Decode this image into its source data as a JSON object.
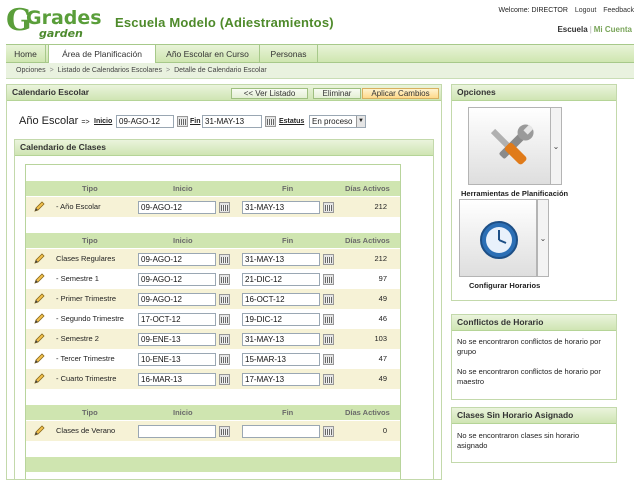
{
  "header": {
    "logo_top": "Grades",
    "logo_bottom": "garden",
    "school_title": "Escuela Modelo (Adiestramientos)",
    "welcome": "Welcome: DIRECTOR",
    "logout": "Logout",
    "feedback": "Feedback",
    "account_active": "Escuela",
    "account_inactive": "Mi Cuenta"
  },
  "nav": {
    "tabs": [
      "Home",
      "Área de Planificación",
      "Año Escolar en Curso",
      "Personas"
    ],
    "active_tab": "Área de Planificación"
  },
  "breadcrumb": [
    "Opciones",
    "Listado de Calendarios Escolares",
    "Detalle de Calendario Escolar"
  ],
  "calendario": {
    "panel_title": "Calendario Escolar",
    "btn_ver_listado": "<< Ver Listado",
    "btn_eliminar": "Eliminar",
    "btn_aplicar": "Aplicar Cambios",
    "anio_label": "Año Escolar",
    "arrow": "=>",
    "inicio_label": "Inicio",
    "inicio_value": "09-AGO-12",
    "fin_label": "Fin",
    "fin_value": "31-MAY-13",
    "estatus_label": "Estatus",
    "estatus_value": "En proceso"
  },
  "clases": {
    "panel_title": "Calendario de Clases",
    "headers": {
      "tipo": "Tipo",
      "inicio": "Inicio",
      "fin": "Fin",
      "dias": "Días Activos"
    },
    "group1": [
      {
        "name": "- Año Escolar",
        "inicio": "09-AGO-12",
        "fin": "31-MAY-13",
        "dias": "212"
      }
    ],
    "group2": [
      {
        "name": "Clases Regulares",
        "inicio": "09-AGO-12",
        "fin": "31-MAY-13",
        "dias": "212"
      },
      {
        "name": "- Semestre 1",
        "inicio": "09-AGO-12",
        "fin": "21-DIC-12",
        "dias": "97"
      },
      {
        "name": "- Primer Trimestre",
        "inicio": "09-AGO-12",
        "fin": "16-OCT-12",
        "dias": "49"
      },
      {
        "name": "- Segundo Trimestre",
        "inicio": "17-OCT-12",
        "fin": "19-DIC-12",
        "dias": "46"
      },
      {
        "name": "- Semestre 2",
        "inicio": "09-ENE-13",
        "fin": "31-MAY-13",
        "dias": "103"
      },
      {
        "name": "- Tercer Trimestre",
        "inicio": "10-ENE-13",
        "fin": "15-MAR-13",
        "dias": "47"
      },
      {
        "name": "- Cuarto Trimestre",
        "inicio": "16-MAR-13",
        "fin": "17-MAY-13",
        "dias": "49"
      }
    ],
    "group3": [
      {
        "name": "Clases de Verano",
        "inicio": "",
        "fin": "",
        "dias": "0"
      }
    ]
  },
  "opciones": {
    "panel_title": "Opciones",
    "tile1_label": "Herramientas de Planificación",
    "tile1_icon": "tools-icon",
    "tile2_label": "Configurar Horarios",
    "tile2_icon": "clock-icon"
  },
  "conflictos": {
    "panel_title": "Conflictos de Horario",
    "msg_grupo": "No se encontraron conflictos de horario por grupo",
    "msg_maestro": "No se encontraron conflictos de horario por maestro"
  },
  "sin_horario": {
    "panel_title": "Clases Sin Horario Asignado",
    "msg": "No se encontraron clases sin horario asignado"
  },
  "colors": {
    "brand_green": "#5a9e3a",
    "header_green": "#cfe5b0",
    "row_yellow": "#f6f2d6",
    "apply_orange": "#ffd98a"
  }
}
